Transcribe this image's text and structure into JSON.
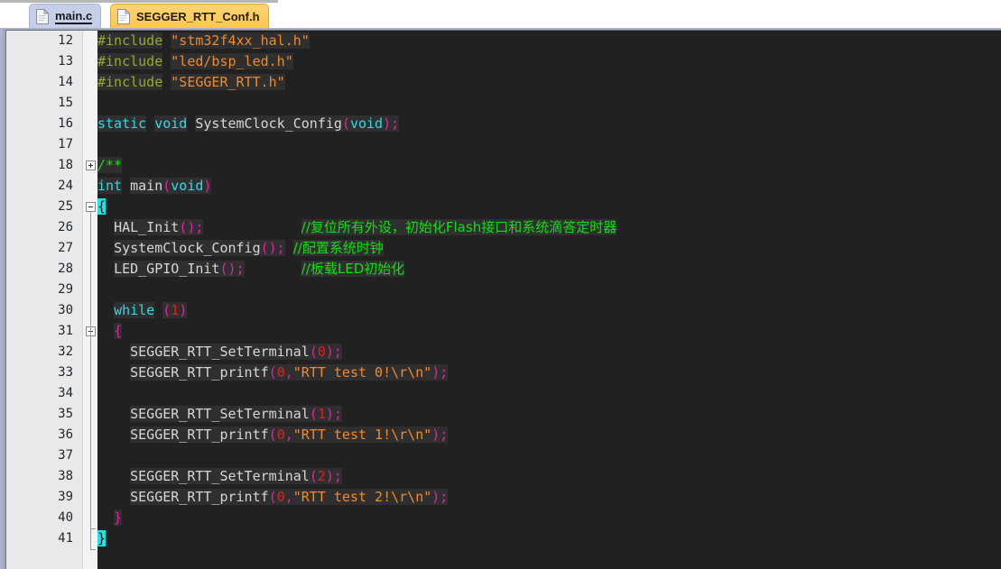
{
  "window": {
    "title": "Code editor"
  },
  "tabs": [
    {
      "label": "main.c",
      "icon": "document-icon",
      "state": "selected"
    },
    {
      "label": "SEGGER_RTT_Conf.h",
      "icon": "document-icon",
      "state": "active"
    }
  ],
  "editor": {
    "background_color": "#212121",
    "token_background_color": "#2f2f2f",
    "gutter_background_color": "#e9e9e9",
    "line_number_color": "#23272e",
    "colors": {
      "keyword": "#2ed9ea",
      "preprocessor": "#9aa82b",
      "string": "#f08a2b",
      "identifier": "#d6d6d6",
      "punctuation": "#e61fa8",
      "number": "#e02020",
      "comment": "#0fe00f",
      "brace_highlight_bg": "#16e8e8",
      "tab_active_bg": "#fcce63",
      "tab_selected_bg": "#c5cfe8"
    },
    "first_visible_line": 12,
    "last_visible_line": 41,
    "line_numbers": [
      12,
      13,
      14,
      15,
      16,
      17,
      18,
      24,
      25,
      26,
      27,
      28,
      29,
      30,
      31,
      32,
      33,
      34,
      35,
      36,
      37,
      38,
      39,
      40,
      41
    ],
    "fold_markers": [
      {
        "line": 18,
        "type": "plus"
      },
      {
        "line": 25,
        "type": "minus"
      },
      {
        "line": 31,
        "type": "minus"
      }
    ],
    "lines": [
      {
        "n": 12,
        "tokens": [
          {
            "t": "#include",
            "c": "pp"
          },
          {
            "t": " ",
            "c": "plain"
          },
          {
            "t": "\"stm32f4xx_hal.h\"",
            "c": "str"
          }
        ]
      },
      {
        "n": 13,
        "tokens": [
          {
            "t": "#include",
            "c": "pp"
          },
          {
            "t": " ",
            "c": "plain"
          },
          {
            "t": "\"led/bsp_led.h\"",
            "c": "str"
          }
        ]
      },
      {
        "n": 14,
        "tokens": [
          {
            "t": "#include",
            "c": "pp"
          },
          {
            "t": " ",
            "c": "plain"
          },
          {
            "t": "\"SEGGER_RTT.h\"",
            "c": "str"
          }
        ]
      },
      {
        "n": 15,
        "tokens": []
      },
      {
        "n": 16,
        "tokens": [
          {
            "t": "static",
            "c": "kw"
          },
          {
            "t": " ",
            "c": "plain"
          },
          {
            "t": "void",
            "c": "kw"
          },
          {
            "t": " ",
            "c": "plain"
          },
          {
            "t": "SystemClock_Config",
            "c": "id"
          },
          {
            "t": "(",
            "c": "pn"
          },
          {
            "t": "void",
            "c": "kw"
          },
          {
            "t": ");",
            "c": "pn"
          }
        ]
      },
      {
        "n": 17,
        "tokens": []
      },
      {
        "n": 18,
        "tokens": [
          {
            "t": "/**",
            "c": "cm"
          }
        ]
      },
      {
        "n": 24,
        "tokens": [
          {
            "t": "int",
            "c": "kw"
          },
          {
            "t": " ",
            "c": "plain"
          },
          {
            "t": "main",
            "c": "id"
          },
          {
            "t": "(",
            "c": "pn"
          },
          {
            "t": "void",
            "c": "kw"
          },
          {
            "t": ")",
            "c": "pn"
          }
        ]
      },
      {
        "n": 25,
        "tokens": [
          {
            "t": "{",
            "c": "brace-hl"
          }
        ]
      },
      {
        "n": 26,
        "tokens": [
          {
            "t": "  ",
            "c": "plain"
          },
          {
            "t": "HAL_Init",
            "c": "id"
          },
          {
            "t": "();",
            "c": "pn"
          },
          {
            "t": "            ",
            "c": "plain"
          },
          {
            "t": "//复位所有外设，初始化Flash接口和系统滴答定时器",
            "c": "cm-cjk"
          }
        ]
      },
      {
        "n": 27,
        "tokens": [
          {
            "t": "  ",
            "c": "plain"
          },
          {
            "t": "SystemClock_Config",
            "c": "id"
          },
          {
            "t": "();",
            "c": "pn"
          },
          {
            "t": " ",
            "c": "plain"
          },
          {
            "t": "//配置系统时钟",
            "c": "cm-cjk"
          }
        ]
      },
      {
        "n": 28,
        "tokens": [
          {
            "t": "  ",
            "c": "plain"
          },
          {
            "t": "LED_GPIO_Init",
            "c": "id"
          },
          {
            "t": "();",
            "c": "pn"
          },
          {
            "t": "       ",
            "c": "plain"
          },
          {
            "t": "//板载LED初始化",
            "c": "cm-cjk"
          }
        ]
      },
      {
        "n": 29,
        "tokens": []
      },
      {
        "n": 30,
        "tokens": [
          {
            "t": "  ",
            "c": "plain"
          },
          {
            "t": "while",
            "c": "kw"
          },
          {
            "t": " ",
            "c": "plain"
          },
          {
            "t": "(",
            "c": "pn"
          },
          {
            "t": "1",
            "c": "num"
          },
          {
            "t": ")",
            "c": "pn"
          }
        ]
      },
      {
        "n": 31,
        "tokens": [
          {
            "t": "  ",
            "c": "plain"
          },
          {
            "t": "{",
            "c": "pn"
          }
        ]
      },
      {
        "n": 32,
        "tokens": [
          {
            "t": "    ",
            "c": "plain"
          },
          {
            "t": "SEGGER_RTT_SetTerminal",
            "c": "id"
          },
          {
            "t": "(",
            "c": "pn"
          },
          {
            "t": "0",
            "c": "num"
          },
          {
            "t": ");",
            "c": "pn"
          }
        ]
      },
      {
        "n": 33,
        "tokens": [
          {
            "t": "    ",
            "c": "plain"
          },
          {
            "t": "SEGGER_RTT_printf",
            "c": "id"
          },
          {
            "t": "(",
            "c": "pn"
          },
          {
            "t": "0",
            "c": "num"
          },
          {
            "t": ",",
            "c": "pn"
          },
          {
            "t": "\"RTT test 0!\\r\\n\"",
            "c": "str"
          },
          {
            "t": ");",
            "c": "pn"
          }
        ]
      },
      {
        "n": 34,
        "tokens": []
      },
      {
        "n": 35,
        "tokens": [
          {
            "t": "    ",
            "c": "plain"
          },
          {
            "t": "SEGGER_RTT_SetTerminal",
            "c": "id"
          },
          {
            "t": "(",
            "c": "pn"
          },
          {
            "t": "1",
            "c": "num"
          },
          {
            "t": ");",
            "c": "pn"
          }
        ]
      },
      {
        "n": 36,
        "tokens": [
          {
            "t": "    ",
            "c": "plain"
          },
          {
            "t": "SEGGER_RTT_printf",
            "c": "id"
          },
          {
            "t": "(",
            "c": "pn"
          },
          {
            "t": "0",
            "c": "num"
          },
          {
            "t": ",",
            "c": "pn"
          },
          {
            "t": "\"RTT test 1!\\r\\n\"",
            "c": "str"
          },
          {
            "t": ");",
            "c": "pn"
          }
        ]
      },
      {
        "n": 37,
        "tokens": []
      },
      {
        "n": 38,
        "tokens": [
          {
            "t": "    ",
            "c": "plain"
          },
          {
            "t": "SEGGER_RTT_SetTerminal",
            "c": "id"
          },
          {
            "t": "(",
            "c": "pn"
          },
          {
            "t": "2",
            "c": "num"
          },
          {
            "t": ");",
            "c": "pn"
          }
        ]
      },
      {
        "n": 39,
        "tokens": [
          {
            "t": "    ",
            "c": "plain"
          },
          {
            "t": "SEGGER_RTT_printf",
            "c": "id"
          },
          {
            "t": "(",
            "c": "pn"
          },
          {
            "t": "0",
            "c": "num"
          },
          {
            "t": ",",
            "c": "pn"
          },
          {
            "t": "\"RTT test 2!\\r\\n\"",
            "c": "str"
          },
          {
            "t": ");",
            "c": "pn"
          }
        ]
      },
      {
        "n": 40,
        "tokens": [
          {
            "t": "  ",
            "c": "plain"
          },
          {
            "t": "}",
            "c": "pn"
          }
        ]
      },
      {
        "n": 41,
        "tokens": [
          {
            "t": "}",
            "c": "brace-hl"
          }
        ]
      }
    ]
  }
}
